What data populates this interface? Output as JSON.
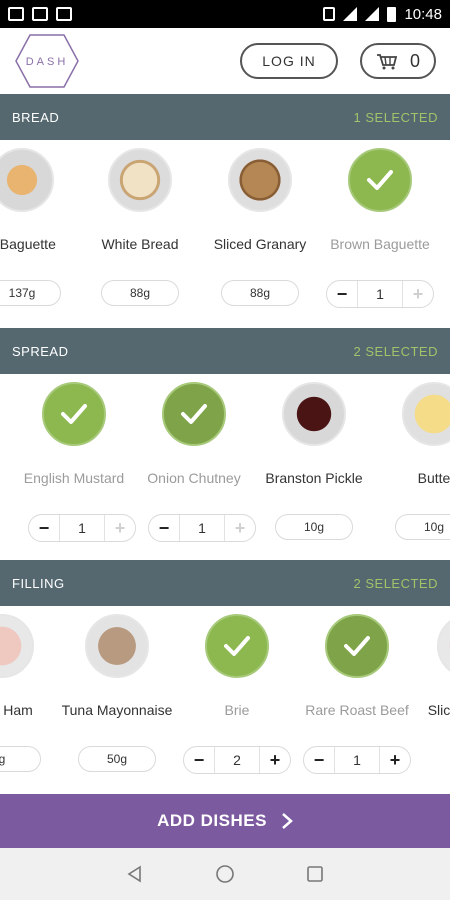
{
  "status_bar": {
    "time": "10:48"
  },
  "header": {
    "logo_text": "DASH",
    "login_label": "LOG IN",
    "cart_count": "0"
  },
  "sections": [
    {
      "title": "BREAD",
      "selected": "1 SELECTED",
      "items": [
        {
          "name": "Brown Baguette",
          "display": "e Baguette",
          "weight": "137g"
        },
        {
          "name": "White Bread",
          "weight": "88g"
        },
        {
          "name": "Sliced Granary",
          "weight": "88g"
        },
        {
          "name": "Brown Baguette",
          "qty": "1"
        }
      ]
    },
    {
      "title": "SPREAD",
      "selected": "2 SELECTED",
      "items": [
        {
          "name": "English Mustard",
          "qty": "1"
        },
        {
          "name": "Onion Chutney",
          "qty": "1"
        },
        {
          "name": "Branston Pickle",
          "weight": "10g"
        },
        {
          "name": "Butte",
          "weight": "10g"
        }
      ]
    },
    {
      "title": "FILLING",
      "selected": "2 SELECTED",
      "items": [
        {
          "name": "Ham",
          "weight": "g"
        },
        {
          "name": "Tuna Mayonnaise",
          "weight": "50g"
        },
        {
          "name": "Brie",
          "qty": "2"
        },
        {
          "name": "Rare Roast Beef",
          "qty": "1"
        },
        {
          "name": "Slic"
        }
      ]
    }
  ],
  "footer": {
    "add_dishes_label": "ADD DISHES"
  },
  "colors": {
    "accent_green": "#8db850",
    "section_bg": "#556870",
    "purple": "#7c5aa0"
  },
  "icons": [
    "gmail-icon",
    "image-icon",
    "chart-icon",
    "vibrate-icon",
    "wifi-icon",
    "signal-icon",
    "battery-icon",
    "cart-icon",
    "check-icon",
    "chevron-right-icon",
    "back-icon",
    "home-icon",
    "recents-icon"
  ]
}
